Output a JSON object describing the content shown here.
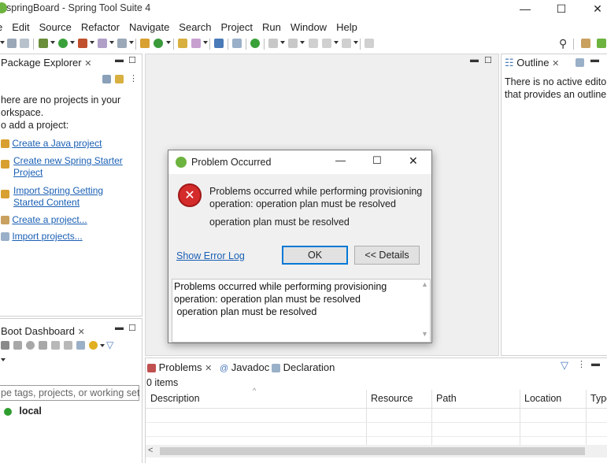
{
  "window": {
    "title": "springBoard - Spring Tool Suite 4"
  },
  "menubar": [
    "e",
    "Edit",
    "Source",
    "Refactor",
    "Navigate",
    "Search",
    "Project",
    "Run",
    "Window",
    "Help"
  ],
  "package_explorer": {
    "tab_title": "Package Explorer",
    "empty_line1": "here are no projects in your",
    "empty_line2": "orkspace.",
    "empty_line3": "o add a project:",
    "links": [
      {
        "line1": "Create a Java project",
        "line2": ""
      },
      {
        "line1": "Create new Spring Starter",
        "line2": "Project"
      },
      {
        "line1": "Import Spring Getting",
        "line2": "Started Content"
      },
      {
        "line1": "Create a project...",
        "line2": ""
      },
      {
        "line1": "Import projects...",
        "line2": ""
      }
    ]
  },
  "boot_dashboard": {
    "tab_title": "Boot Dashboard",
    "filter_placeholder": "pe tags, projects, or working set",
    "item": "local"
  },
  "outline": {
    "tab_title": "Outline",
    "message_line1": "There is no active editor",
    "message_line2": "that provides an outline."
  },
  "bottom_tabs": {
    "problems": "Problems",
    "javadoc": "Javadoc",
    "declaration": "Declaration"
  },
  "problems": {
    "count": "0 items",
    "columns": [
      "Description",
      "Resource",
      "Path",
      "Location",
      "Type"
    ]
  },
  "dialog": {
    "title": "Problem Occurred",
    "message_line1": "Problems occurred while performing provisioning",
    "message_line2": "operation: operation plan must be resolved",
    "message_line3": "operation plan must be resolved",
    "show_error_log": "Show Error Log",
    "ok": "OK",
    "details": "<< Details",
    "details_lines": [
      "Problems occurred while performing provisioning",
      "operation: operation plan must be resolved",
      " operation plan must be resolved"
    ]
  },
  "colors": {
    "link": "#1a5fb4",
    "error_red": "#d42b2b",
    "spring_green": "#6db33f",
    "focus_blue": "#0078d7"
  }
}
